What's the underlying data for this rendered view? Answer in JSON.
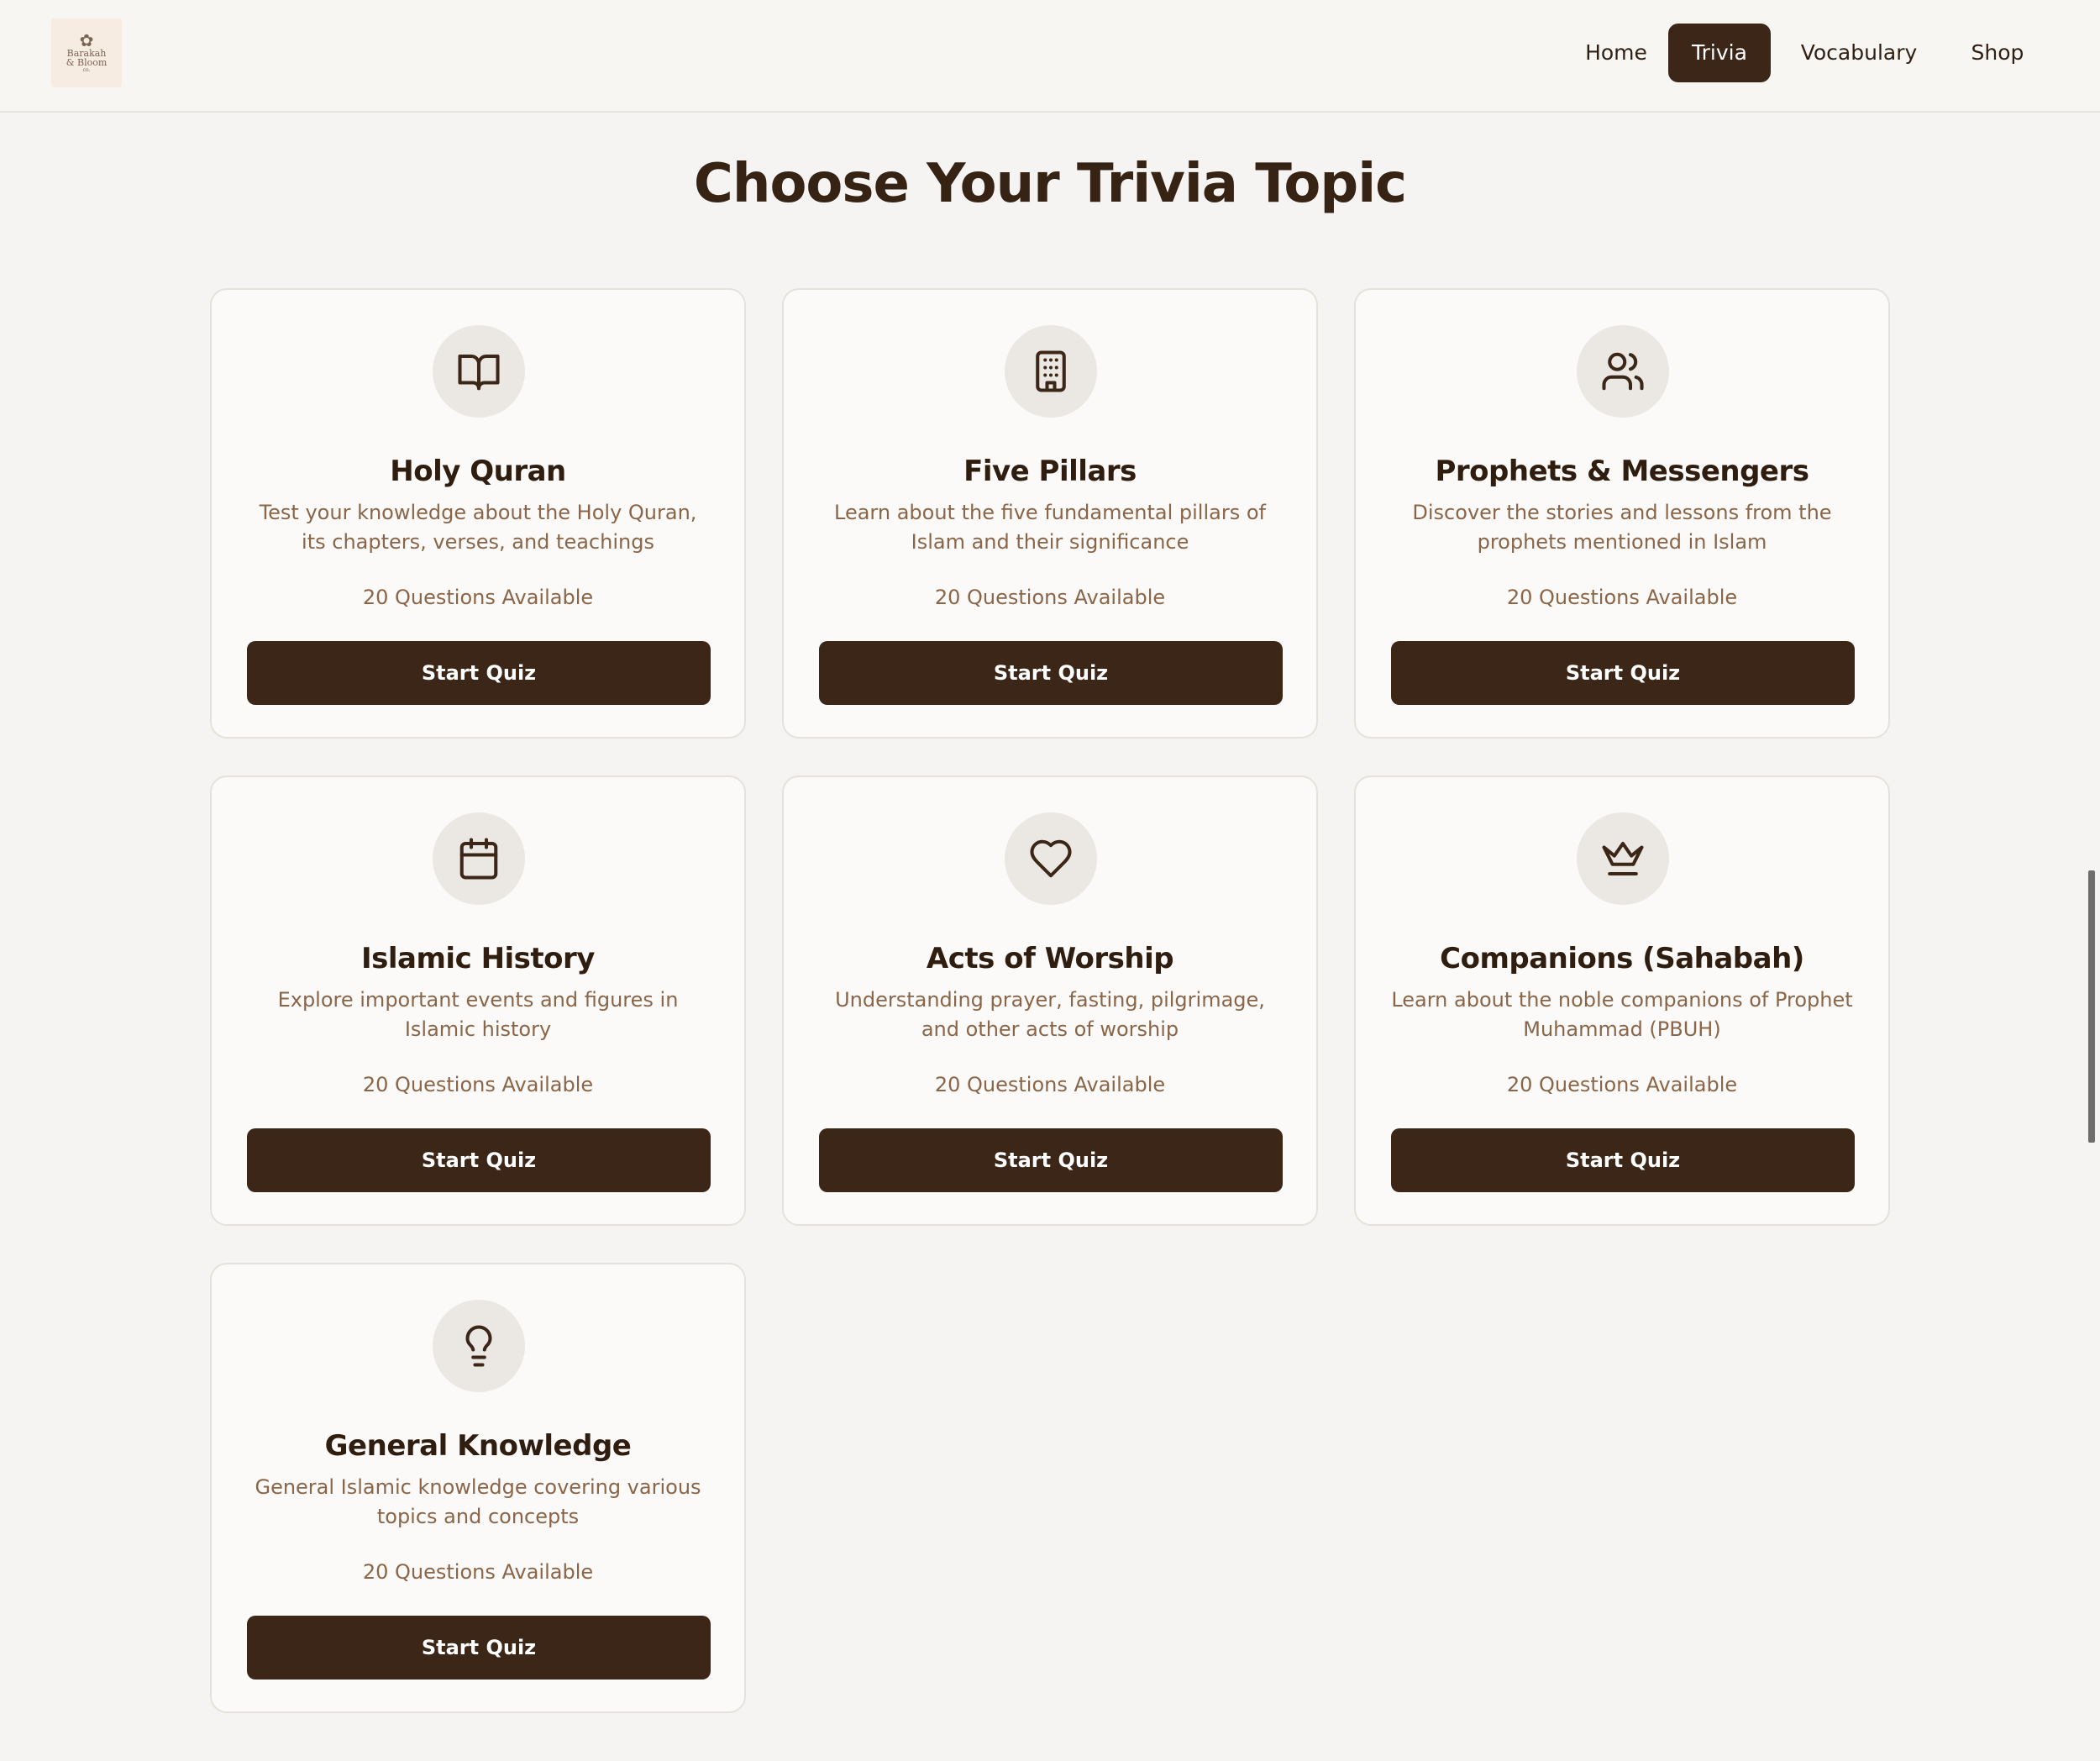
{
  "header": {
    "logo": {
      "line1": "Barakah",
      "line2": "& Bloom",
      "line3": "co."
    },
    "nav": [
      {
        "label": "Home",
        "active": false
      },
      {
        "label": "Trivia",
        "active": true
      },
      {
        "label": "Vocabulary",
        "active": false
      },
      {
        "label": "Shop",
        "active": false
      }
    ]
  },
  "page": {
    "title": "Choose Your Trivia Topic"
  },
  "topics": [
    {
      "icon": "book-open-icon",
      "title": "Holy Quran",
      "description": "Test your knowledge about the Holy Quran, its chapters, verses, and teachings",
      "count": "20 Questions Available",
      "button": "Start Quiz"
    },
    {
      "icon": "building-icon",
      "title": "Five Pillars",
      "description": "Learn about the five fundamental pillars of Islam and their significance",
      "count": "20 Questions Available",
      "button": "Start Quiz"
    },
    {
      "icon": "users-icon",
      "title": "Prophets & Messengers",
      "description": "Discover the stories and lessons from the prophets mentioned in Islam",
      "count": "20 Questions Available",
      "button": "Start Quiz"
    },
    {
      "icon": "calendar-icon",
      "title": "Islamic History",
      "description": "Explore important events and figures in Islamic history",
      "count": "20 Questions Available",
      "button": "Start Quiz"
    },
    {
      "icon": "heart-icon",
      "title": "Acts of Worship",
      "description": "Understanding prayer, fasting, pilgrimage, and other acts of worship",
      "count": "20 Questions Available",
      "button": "Start Quiz"
    },
    {
      "icon": "crown-icon",
      "title": "Companions (Sahabah)",
      "description": "Learn about the noble companions of Prophet Muhammad (PBUH)",
      "count": "20 Questions Available",
      "button": "Start Quiz"
    },
    {
      "icon": "lightbulb-icon",
      "title": "General Knowledge",
      "description": "General Islamic knowledge covering various topics and concepts",
      "count": "20 Questions Available",
      "button": "Start Quiz"
    }
  ],
  "colors": {
    "accent": "#3b2617",
    "muted_text": "#8a6548",
    "background": "#f5f4f2"
  }
}
